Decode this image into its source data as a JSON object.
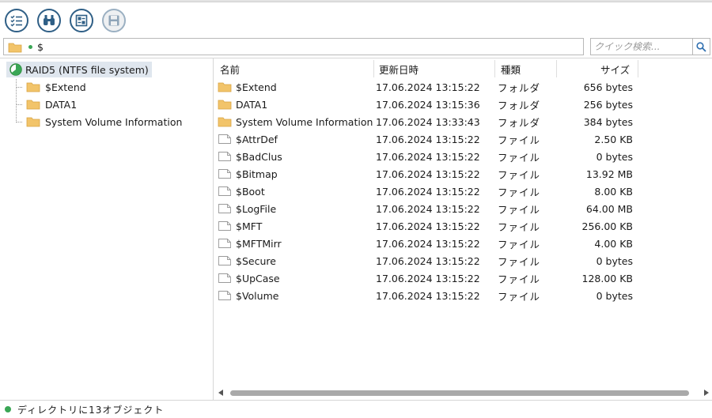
{
  "toolbar": {
    "buttons": [
      {
        "name": "list-icon"
      },
      {
        "name": "binoculars-icon"
      },
      {
        "name": "preview-icon"
      },
      {
        "name": "save-icon"
      }
    ]
  },
  "path": {
    "value": "$"
  },
  "search": {
    "placeholder": "クイック検索..."
  },
  "tree": {
    "root": "RAID5 (NTFS file system)",
    "children": [
      "$Extend",
      "DATA1",
      "System Volume Information"
    ]
  },
  "columns": {
    "name": "名前",
    "date": "更新日時",
    "type": "種類",
    "size": "サイズ"
  },
  "files": [
    {
      "name": "$Extend",
      "date": "17.06.2024 13:15:22",
      "type": "フォルダ",
      "size": "656 bytes",
      "kind": "folder"
    },
    {
      "name": "DATA1",
      "date": "17.06.2024 13:15:36",
      "type": "フォルダ",
      "size": "256 bytes",
      "kind": "folder"
    },
    {
      "name": "System Volume Information",
      "date": "17.06.2024 13:33:43",
      "type": "フォルダ",
      "size": "384 bytes",
      "kind": "folder"
    },
    {
      "name": "$AttrDef",
      "date": "17.06.2024 13:15:22",
      "type": "ファイル",
      "size": "2.50 KB",
      "kind": "file"
    },
    {
      "name": "$BadClus",
      "date": "17.06.2024 13:15:22",
      "type": "ファイル",
      "size": "0 bytes",
      "kind": "file"
    },
    {
      "name": "$Bitmap",
      "date": "17.06.2024 13:15:22",
      "type": "ファイル",
      "size": "13.92 MB",
      "kind": "file"
    },
    {
      "name": "$Boot",
      "date": "17.06.2024 13:15:22",
      "type": "ファイル",
      "size": "8.00 KB",
      "kind": "file"
    },
    {
      "name": "$LogFile",
      "date": "17.06.2024 13:15:22",
      "type": "ファイル",
      "size": "64.00 MB",
      "kind": "file"
    },
    {
      "name": "$MFT",
      "date": "17.06.2024 13:15:22",
      "type": "ファイル",
      "size": "256.00 KB",
      "kind": "file"
    },
    {
      "name": "$MFTMirr",
      "date": "17.06.2024 13:15:22",
      "type": "ファイル",
      "size": "4.00 KB",
      "kind": "file"
    },
    {
      "name": "$Secure",
      "date": "17.06.2024 13:15:22",
      "type": "ファイル",
      "size": "0 bytes",
      "kind": "file"
    },
    {
      "name": "$UpCase",
      "date": "17.06.2024 13:15:22",
      "type": "ファイル",
      "size": "128.00 KB",
      "kind": "file"
    },
    {
      "name": "$Volume",
      "date": "17.06.2024 13:15:22",
      "type": "ファイル",
      "size": "0 bytes",
      "kind": "file"
    }
  ],
  "status": {
    "text": "ディレクトリに13オブジェクト"
  },
  "colors": {
    "folder": "#f2c46a",
    "accent": "#2f5f86",
    "status_dot": "#3aa655",
    "selection": "#dfe6ee"
  }
}
